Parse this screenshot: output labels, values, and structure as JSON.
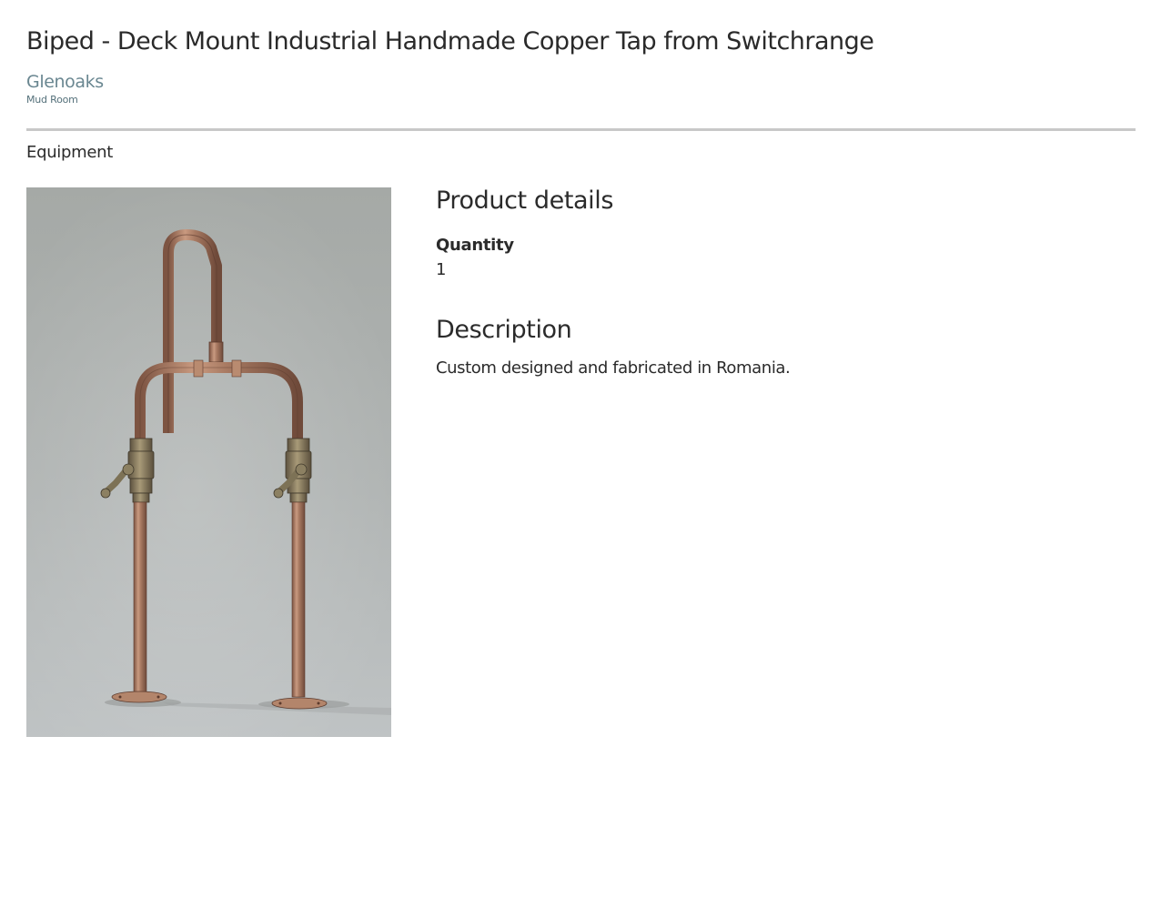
{
  "header": {
    "title": "Biped - Deck Mount Industrial Handmade Copper Tap from Switchrange",
    "project": "Glenoaks",
    "room": "Mud Room"
  },
  "category": "Equipment",
  "details": {
    "heading": "Product details",
    "quantity_label": "Quantity",
    "quantity_value": "1",
    "description_heading": "Description",
    "description_text": "Custom designed and fabricated in Romania."
  },
  "colors": {
    "project_link": "#6a8791",
    "divider": "#c8c8c8",
    "text": "#2b2b2b",
    "copper": "#b07a5e",
    "photo_background": "#a8acaa"
  }
}
